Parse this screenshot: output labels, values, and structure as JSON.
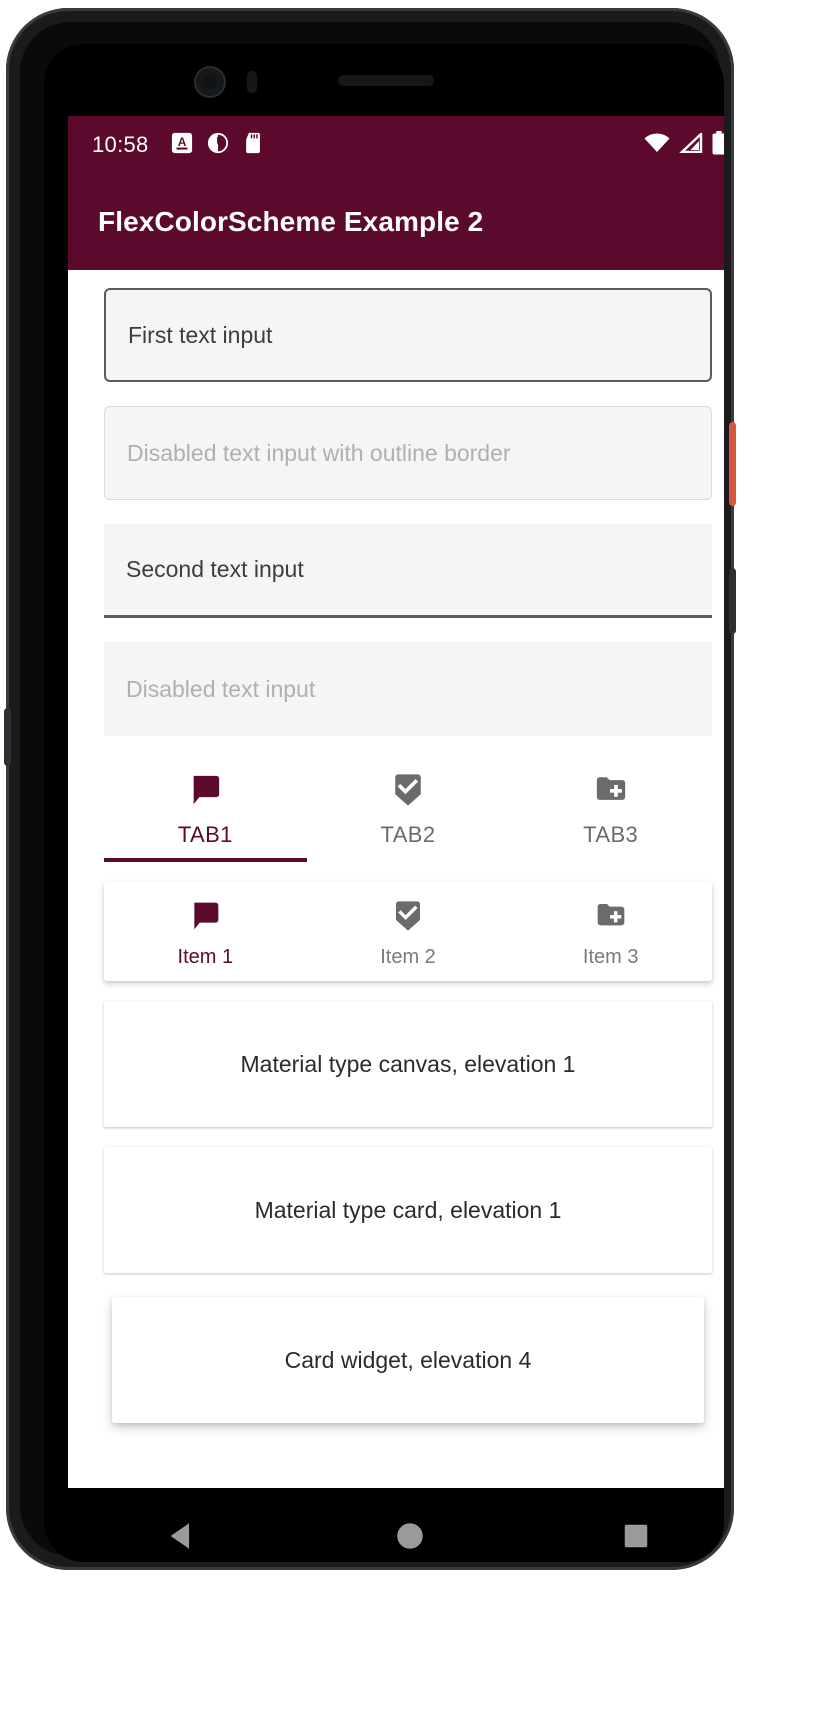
{
  "status_bar": {
    "clock": "10:58",
    "left_icons": [
      "font-size-a-icon",
      "clock-alarm-icon",
      "sd-card-icon"
    ],
    "right_icons": [
      "wifi-icon",
      "cellular-signal-icon",
      "battery-full-icon"
    ]
  },
  "app_bar": {
    "title": "FlexColorScheme Example 2"
  },
  "text_fields": [
    {
      "label": "First text input",
      "style": "outline",
      "disabled": false
    },
    {
      "label": "Disabled text input with outline border",
      "style": "outline",
      "disabled": true
    },
    {
      "label": "Second text input",
      "style": "underline",
      "disabled": false
    },
    {
      "label": "Disabled text input",
      "style": "underline",
      "disabled": true
    }
  ],
  "tab_bar": {
    "tabs": [
      {
        "label": "TAB1",
        "icon": "chat-bubble-icon",
        "active": true
      },
      {
        "label": "TAB2",
        "icon": "beenhere-check-icon",
        "active": false
      },
      {
        "label": "TAB3",
        "icon": "create-new-folder-icon",
        "active": false
      }
    ]
  },
  "bottom_nav": {
    "items": [
      {
        "label": "Item 1",
        "icon": "chat-bubble-icon",
        "active": true
      },
      {
        "label": "Item 2",
        "icon": "beenhere-check-icon",
        "active": false
      },
      {
        "label": "Item 3",
        "icon": "create-new-folder-icon",
        "active": false
      }
    ]
  },
  "cards": [
    {
      "label": "Material type canvas, elevation 1",
      "elevation": "1"
    },
    {
      "label": "Material type card, elevation 1",
      "elevation": "1"
    },
    {
      "label": "Card widget, elevation 4",
      "elevation": "4"
    }
  ],
  "android_nav": {
    "buttons": [
      "back-triangle-icon",
      "home-circle-icon",
      "recents-square-icon"
    ]
  },
  "colors": {
    "primary": "#5B0A2E",
    "on_primary": "#FFFFFF",
    "field_fill": "#F5F5F5",
    "inactive": "#6B6B6B",
    "disabled_text": "#B0B0B0"
  }
}
